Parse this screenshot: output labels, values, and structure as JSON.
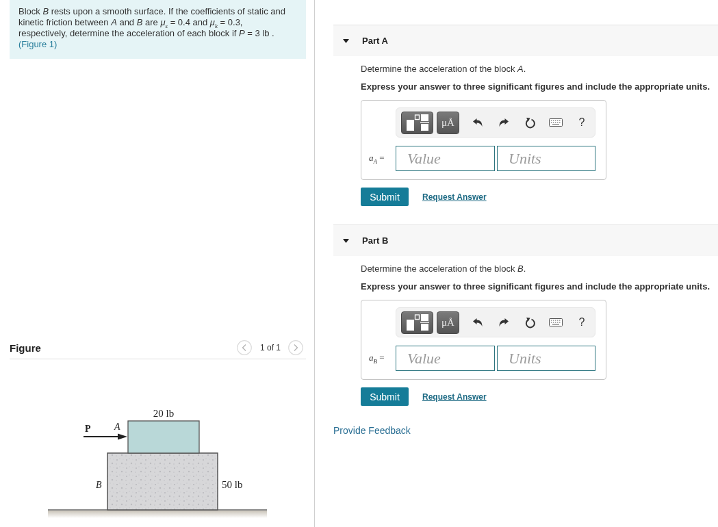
{
  "problem": {
    "text": "Block *B* rests upon a smooth surface. If the coefficients of static and kinetic friction between *A* and *B* are *μ*$_{s}$ = 0.4 and *μ*$_{k}$ = 0.3, respectively, determine the acceleration of each block if *P* = 3 lb .",
    "link": "(Figure 1)"
  },
  "figure": {
    "title": "Figure",
    "pager": "1 of 1",
    "labels": {
      "force": "P",
      "block_a": "A",
      "block_a_weight": "20 lb",
      "block_b": "B",
      "block_b_weight": "50 lb"
    }
  },
  "parts": [
    {
      "title": "Part A",
      "expanded": true,
      "question": "Determine the acceleration of the block *A*.",
      "instruction": "Express your answer to three significant figures and include the appropriate units.",
      "units_button": "μÅ",
      "help": "?",
      "variable": "*a*$_{A}$ =",
      "value_placeholder": "Value",
      "units_placeholder": "Units",
      "submit": "Submit",
      "request": "Request Answer"
    },
    {
      "title": "Part B",
      "expanded": true,
      "question": "Determine the acceleration of the block *B*.",
      "instruction": "Express your answer to three significant figures and include the appropriate units.",
      "units_button": "μÅ",
      "help": "?",
      "variable": "*a*$_{B}$ =",
      "value_placeholder": "Value",
      "units_placeholder": "Units",
      "submit": "Submit",
      "request": "Request Answer"
    }
  ],
  "feedback": "Provide Feedback"
}
